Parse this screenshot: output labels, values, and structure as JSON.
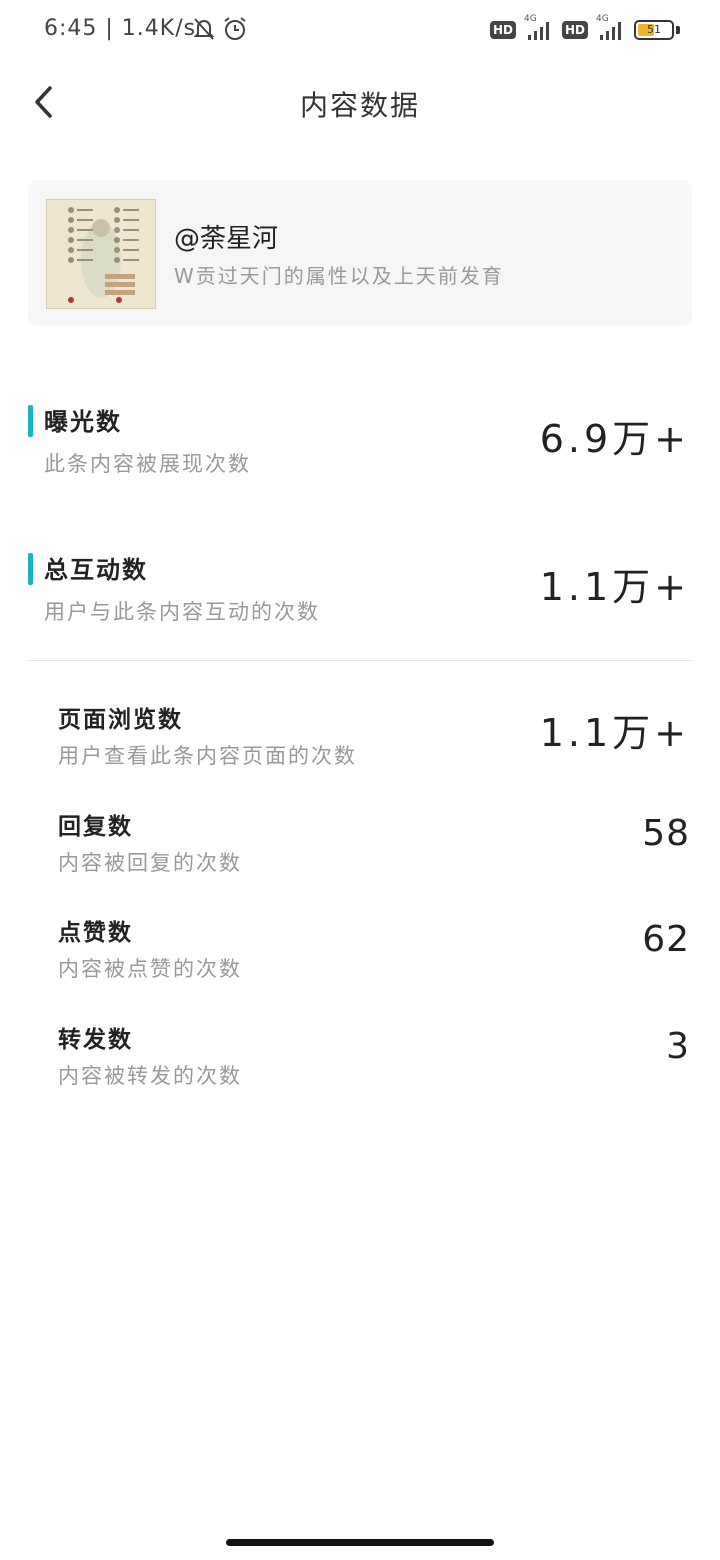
{
  "status_bar": {
    "time": "6:45 | 1.4K/s",
    "network_badge": "HD",
    "signal_label": "4G",
    "battery_level": "51",
    "battery_fraction": 0.51,
    "icons": [
      "bell-muted-icon",
      "alarm-icon",
      "signal-icon",
      "battery-icon"
    ]
  },
  "nav": {
    "title": "内容数据",
    "back_icon": "chevron-left-icon"
  },
  "post": {
    "author": "@荼星河",
    "description": "W贡过天门的属性以及上天前发育"
  },
  "metrics_primary": [
    {
      "label": "曝光数",
      "desc": "此条内容被展现次数",
      "value": "6.9万+"
    },
    {
      "label": "总互动数",
      "desc": "用户与此条内容互动的次数",
      "value": "1.1万+"
    }
  ],
  "metrics_detail": [
    {
      "label": "页面浏览数",
      "desc": "用户查看此条内容页面的次数",
      "value": "1.1万+"
    },
    {
      "label": "回复数",
      "desc": "内容被回复的次数",
      "value": "58"
    },
    {
      "label": "点赞数",
      "desc": "内容被点赞的次数",
      "value": "62"
    },
    {
      "label": "转发数",
      "desc": "内容被转发的次数",
      "value": "3"
    }
  ],
  "colors": {
    "accent": "#1bb3c2",
    "card_bg": "#f6f6f6",
    "muted_text": "#999999",
    "battery": "#f0b429"
  }
}
